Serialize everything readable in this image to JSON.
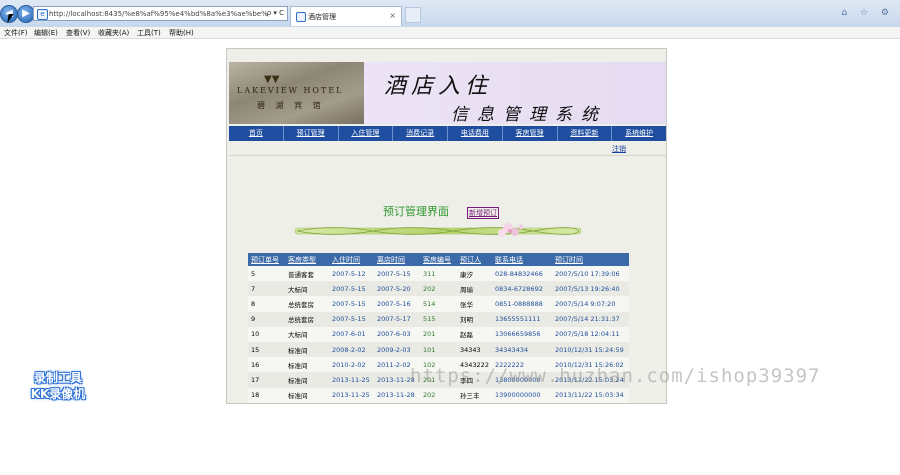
{
  "browser": {
    "back_label": "◀",
    "forward_label": "▶",
    "url": "http://localhost:8435/%e8%af%95%e4%bd%8a%e3%ae%be%",
    "address_tools": "ρ ▾ C",
    "tab_title": "酒店管理",
    "tab_close": "×",
    "window_icons": "⌂ ☆ ⚙"
  },
  "menu": {
    "items": [
      "文件(F)",
      "编辑(E)",
      "查看(V)",
      "收藏夹(A)",
      "工具(T)",
      "帮助(H)"
    ]
  },
  "banner": {
    "logo_en": "LAKEVIEW HOTEL",
    "logo_cn": "碧 湖 宾 馆",
    "title_line1": "酒店入住",
    "title_line2": "信息管理系统"
  },
  "nav": {
    "items": [
      "首页",
      "预订管理",
      "入住管理",
      "消费记录",
      "电话费用",
      "客房管理",
      "资料更新",
      "系统维护"
    ],
    "logout": "注销"
  },
  "page": {
    "title": "预订管理界面",
    "link": "新增预订"
  },
  "table": {
    "headers": [
      "预订单号",
      "客房类型",
      "入住时间",
      "离店时间",
      "客房编号",
      "预订人",
      "联系电话",
      "预订时间"
    ],
    "rows": [
      [
        "5",
        "普通客套",
        "2007-5-12",
        "2007-5-15",
        "311",
        "康汐",
        "028-84832466",
        "2007/5/10 17:39:06"
      ],
      [
        "7",
        "大标间",
        "2007-5-15",
        "2007-5-20",
        "202",
        "周瑜",
        "0834-6728692",
        "2007/5/13 19:26:40"
      ],
      [
        "8",
        "总统套房",
        "2007-5-15",
        "2007-5-16",
        "514",
        "张华",
        "0851-0888888",
        "2007/5/14 9:07:20"
      ],
      [
        "9",
        "总统套房",
        "2007-5-15",
        "2007-5-17",
        "515",
        "刘明",
        "13655551111",
        "2007/5/14 21:31:37"
      ],
      [
        "10",
        "大标间",
        "2007-6-01",
        "2007-6-03",
        "201",
        "赵磊",
        "13066659856",
        "2007/5/18 12:04:11"
      ],
      [
        "15",
        "标准间",
        "2008-2-02",
        "2009-2-03",
        "101",
        "34343",
        "34343434",
        "2010/12/31 15:24:59"
      ],
      [
        "16",
        "标准间",
        "2010-2-02",
        "2011-2-02",
        "102",
        "4343222",
        "2222222",
        "2010/12/31 15:26:02"
      ],
      [
        "17",
        "标准间",
        "2013-11-25",
        "2013-11-28",
        "201",
        "李四",
        "13800000000",
        "2013/11/22 15:03:24"
      ],
      [
        "18",
        "标准间",
        "2013-11-25",
        "2013-11-28",
        "202",
        "孙三丰",
        "13900000000",
        "2013/11/22 15:03:34"
      ]
    ]
  },
  "overlay": {
    "watermark": "https://www.huzhan.com/ishop39397",
    "rec_line1": "录制工具",
    "rec_line2": "KK录像机"
  },
  "colors": {
    "nav_bg": "#1f4ea0",
    "table_header": "#3c6aa8",
    "title_green": "#2f9a2f"
  }
}
